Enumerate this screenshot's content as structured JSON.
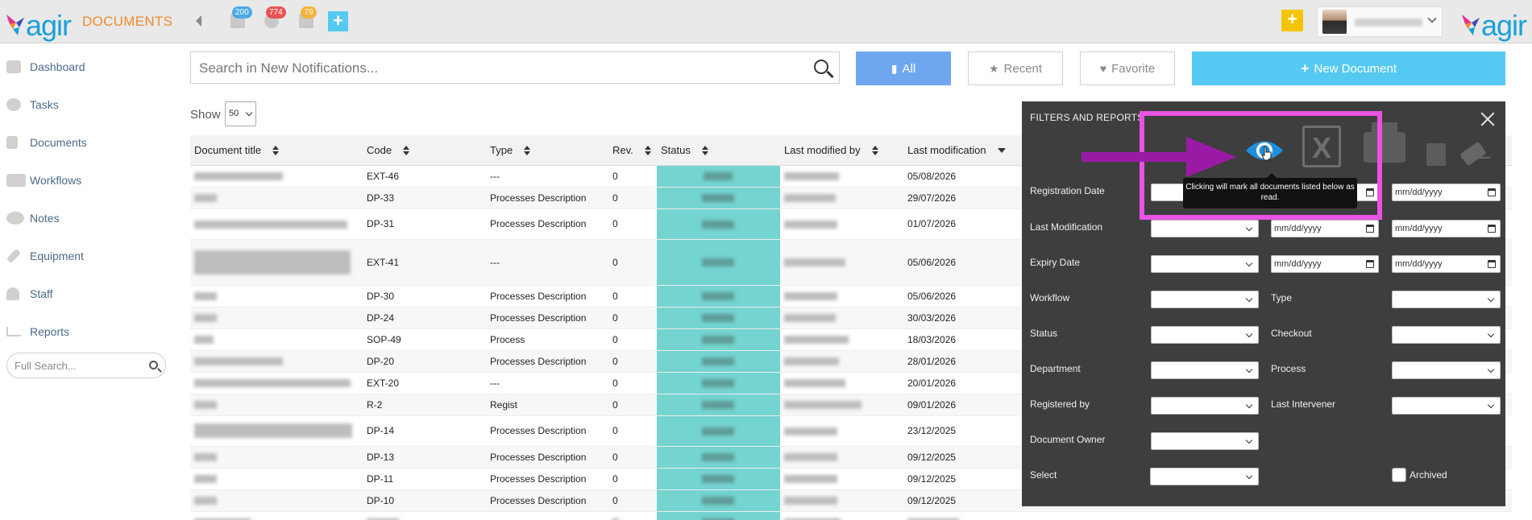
{
  "app": {
    "logo_text": "agir",
    "section_title": "DOCUMENTS"
  },
  "topbar": {
    "badges": [
      {
        "icon": "calendar-icon",
        "count": "200",
        "color": "#4aa9e8"
      },
      {
        "icon": "gear-icon",
        "count": "774",
        "color": "#e85454"
      },
      {
        "icon": "note-icon",
        "count": "79",
        "color": "#f3b43a"
      }
    ],
    "add_button_color": "#55c9f2",
    "quick_add_color": "#f5c400"
  },
  "sidebar": {
    "items": [
      {
        "label": "Dashboard",
        "icon": "home-icon"
      },
      {
        "label": "Tasks",
        "icon": "gear-icon"
      },
      {
        "label": "Documents",
        "icon": "document-icon"
      },
      {
        "label": "Workflows",
        "icon": "workflow-icon"
      },
      {
        "label": "Notes",
        "icon": "notes-icon"
      },
      {
        "label": "Equipment",
        "icon": "wrench-icon"
      },
      {
        "label": "Staff",
        "icon": "user-icon"
      },
      {
        "label": "Reports",
        "icon": "chart-icon"
      }
    ],
    "search_placeholder": "Full Search..."
  },
  "search": {
    "placeholder": "Search in New Notifications..."
  },
  "filters": {
    "all": "All",
    "recent": "Recent",
    "favorite": "Favorite",
    "new_document": "New Document"
  },
  "show": {
    "label": "Show",
    "value": "50"
  },
  "table": {
    "headers": {
      "title": "Document title",
      "code": "Code",
      "type": "Type",
      "rev": "Rev.",
      "status": "Status",
      "modified_by": "Last modified by",
      "modification": "Last modification"
    },
    "rows": [
      {
        "code": "EXT-46",
        "type": "---",
        "rev": "0",
        "date": "05/08/2026"
      },
      {
        "code": "DP-33",
        "type": "Processes Description",
        "rev": "0",
        "date": "29/07/2026"
      },
      {
        "code": "DP-31",
        "type": "Processes Description",
        "rev": "0",
        "date": "01/07/2026"
      },
      {
        "code": "EXT-41",
        "type": "---",
        "rev": "0",
        "date": "05/06/2026"
      },
      {
        "code": "DP-30",
        "type": "Processes Description",
        "rev": "0",
        "date": "05/06/2026"
      },
      {
        "code": "DP-24",
        "type": "Processes Description",
        "rev": "0",
        "date": "30/03/2026"
      },
      {
        "code": "SOP-49",
        "type": "Process",
        "rev": "0",
        "date": "18/03/2026"
      },
      {
        "code": "DP-20",
        "type": "Processes Description",
        "rev": "0",
        "date": "28/01/2026"
      },
      {
        "code": "EXT-20",
        "type": "---",
        "rev": "0",
        "date": "20/01/2026"
      },
      {
        "code": "R-2",
        "type": "Regist",
        "rev": "0",
        "date": "09/01/2026"
      },
      {
        "code": "DP-14",
        "type": "Processes Description",
        "rev": "0",
        "date": "23/12/2025"
      },
      {
        "code": "DP-13",
        "type": "Processes Description",
        "rev": "0",
        "date": "09/12/2025"
      },
      {
        "code": "DP-11",
        "type": "Processes Description",
        "rev": "0",
        "date": "09/12/2025"
      },
      {
        "code": "DP-10",
        "type": "Processes Description",
        "rev": "0",
        "date": "09/12/2025"
      }
    ]
  },
  "panel": {
    "title": "FILTERS AND REPORTS",
    "tooltip": "Clicking will mark all documents listed below as read.",
    "date_placeholder": "mm/dd/yyyy",
    "labels": {
      "registration_date": "Registration Date",
      "last_modification": "Last Modification",
      "expiry_date": "Expiry Date",
      "workflow": "Workflow",
      "type": "Type",
      "status": "Status",
      "checkout": "Checkout",
      "department": "Department",
      "process": "Process",
      "registered_by": "Registered by",
      "last_intervener": "Last Intervener",
      "document_owner": "Document Owner",
      "select": "Select",
      "archived": "Archived"
    }
  },
  "annotation": {
    "highlight_color": "#ea52e4",
    "arrow_color": "#9a1aa6"
  }
}
